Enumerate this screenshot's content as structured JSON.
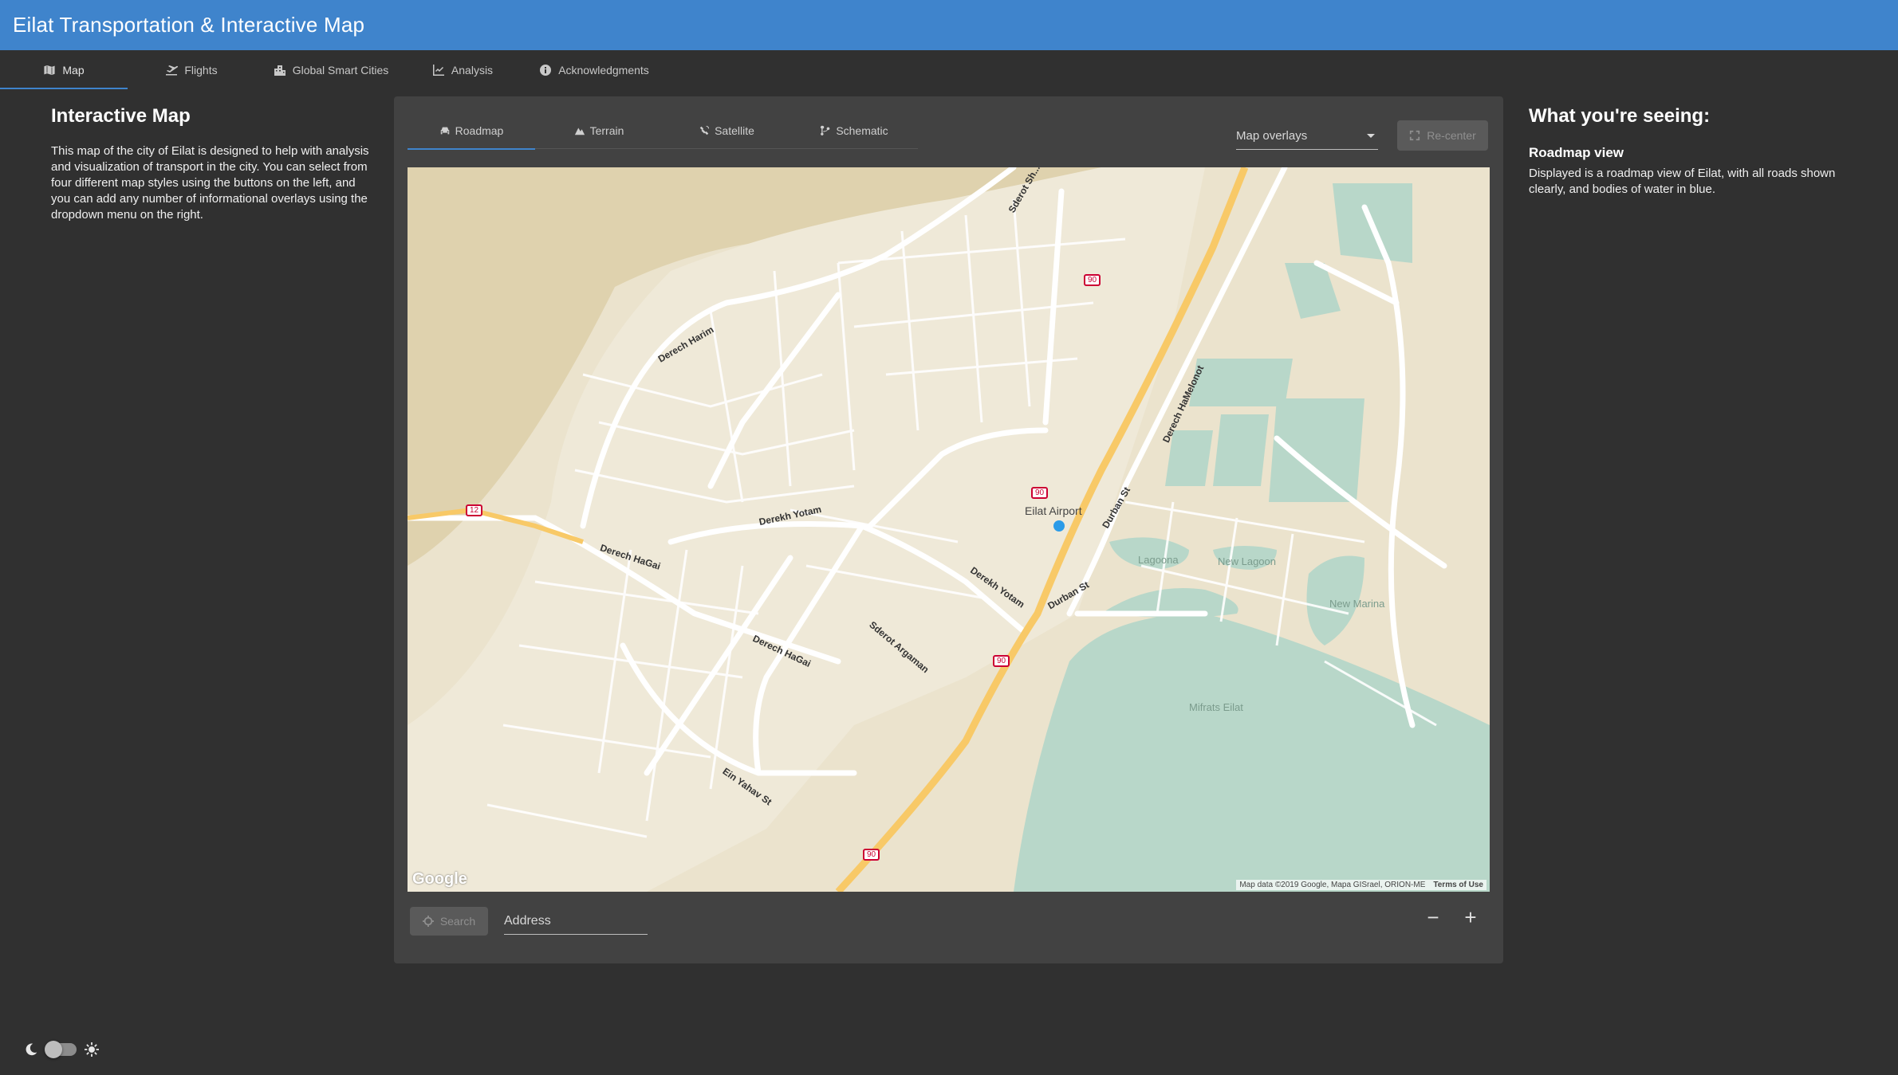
{
  "app": {
    "title": "Eilat Transportation & Interactive Map"
  },
  "nav": {
    "tabs": [
      {
        "label": "Map",
        "icon": "map-icon",
        "active": true
      },
      {
        "label": "Flights",
        "icon": "plane-icon",
        "active": false
      },
      {
        "label": "Global Smart Cities",
        "icon": "city-icon",
        "active": false
      },
      {
        "label": "Analysis",
        "icon": "chart-icon",
        "active": false
      },
      {
        "label": "Acknowledgments",
        "icon": "info-icon",
        "active": false
      }
    ]
  },
  "left": {
    "title": "Interactive Map",
    "description": "This map of the city of Eilat is designed to help with analysis and visualization of transport in the city. You can select from four different map styles using the buttons on the left, and you can add any number of informational overlays using the dropdown menu on the right."
  },
  "map_panel": {
    "style_tabs": [
      {
        "label": "Roadmap",
        "icon": "car-icon",
        "active": true
      },
      {
        "label": "Terrain",
        "icon": "mountain-icon",
        "active": false
      },
      {
        "label": "Satellite",
        "icon": "satellite-icon",
        "active": false
      },
      {
        "label": "Schematic",
        "icon": "branch-icon",
        "active": false
      }
    ],
    "overlays_label": "Map overlays",
    "recenter_label": "Re-center",
    "search_label": "Search",
    "address_placeholder": "Address",
    "zoom_out_label": "−",
    "zoom_in_label": "+",
    "map": {
      "logo": "Google",
      "attribution": "Map data ©2019 Google, Mapa GISrael, ORION-ME",
      "terms": "Terms of Use",
      "labels": {
        "airport": "Eilat Airport",
        "lagoona": "Lagoona",
        "new_lagoon": "New Lagoon",
        "new_marina": "New Marina",
        "mifrats": "Mifrats Eilat",
        "derech_harim": "Derech Harim",
        "derekh_yotam": "Derekh Yotam",
        "derech_hagai": "Derech HaGai",
        "derech_hagai2": "Derech HaGai",
        "derekh_yotam2": "Derekh Yotam",
        "sderot_argaman": "Sderot Argaman",
        "ein_yahav": "Ein Yahav St",
        "durban": "Durban St",
        "durban2": "Durban St",
        "hamelonot": "Derech HaMelonot",
        "sderot_sh": "Sderot Sh...",
        "r90": "90",
        "r12": "12"
      }
    }
  },
  "right": {
    "title": "What you're seeing:",
    "view_title": "Roadmap view",
    "view_description": "Displayed is a roadmap view of Eilat, with all roads shown clearly, and bodies of water in blue."
  },
  "colors": {
    "appbar": "#3f84cc",
    "background": "#303030",
    "card": "#424242",
    "land": "#dfd2ae",
    "water": "#b8d7c9",
    "highway": "#f8c967"
  }
}
